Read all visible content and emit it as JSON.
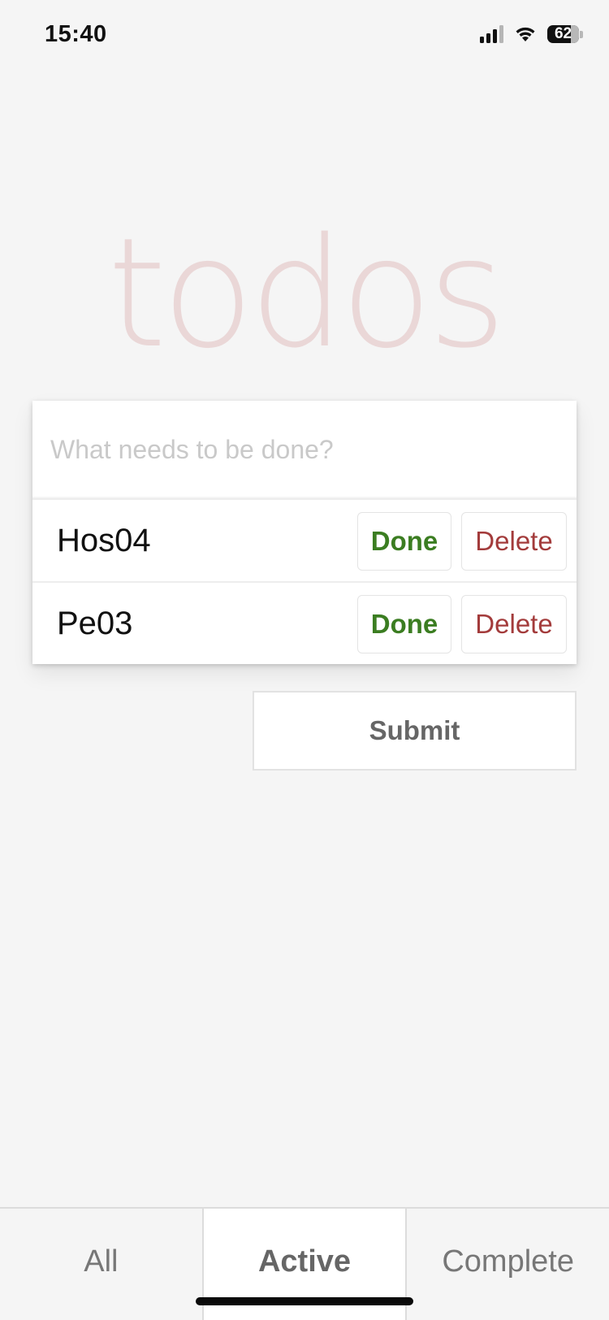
{
  "status_bar": {
    "time": "15:40",
    "battery": "62"
  },
  "app": {
    "title": "todos"
  },
  "new_todo": {
    "placeholder": "What needs to be done?",
    "value": ""
  },
  "todos": [
    {
      "text": "Hos04",
      "done_label": "Done",
      "delete_label": "Delete"
    },
    {
      "text": "Pe03",
      "done_label": "Done",
      "delete_label": "Delete"
    }
  ],
  "submit": {
    "label": "Submit"
  },
  "filters": {
    "selected": "Active",
    "tabs": [
      {
        "label": "All"
      },
      {
        "label": "Active"
      },
      {
        "label": "Complete"
      }
    ]
  },
  "colors": {
    "done": "#3b7d21",
    "delete": "#a33b3b",
    "title": "#ead7d7",
    "background": "#f5f5f5"
  }
}
